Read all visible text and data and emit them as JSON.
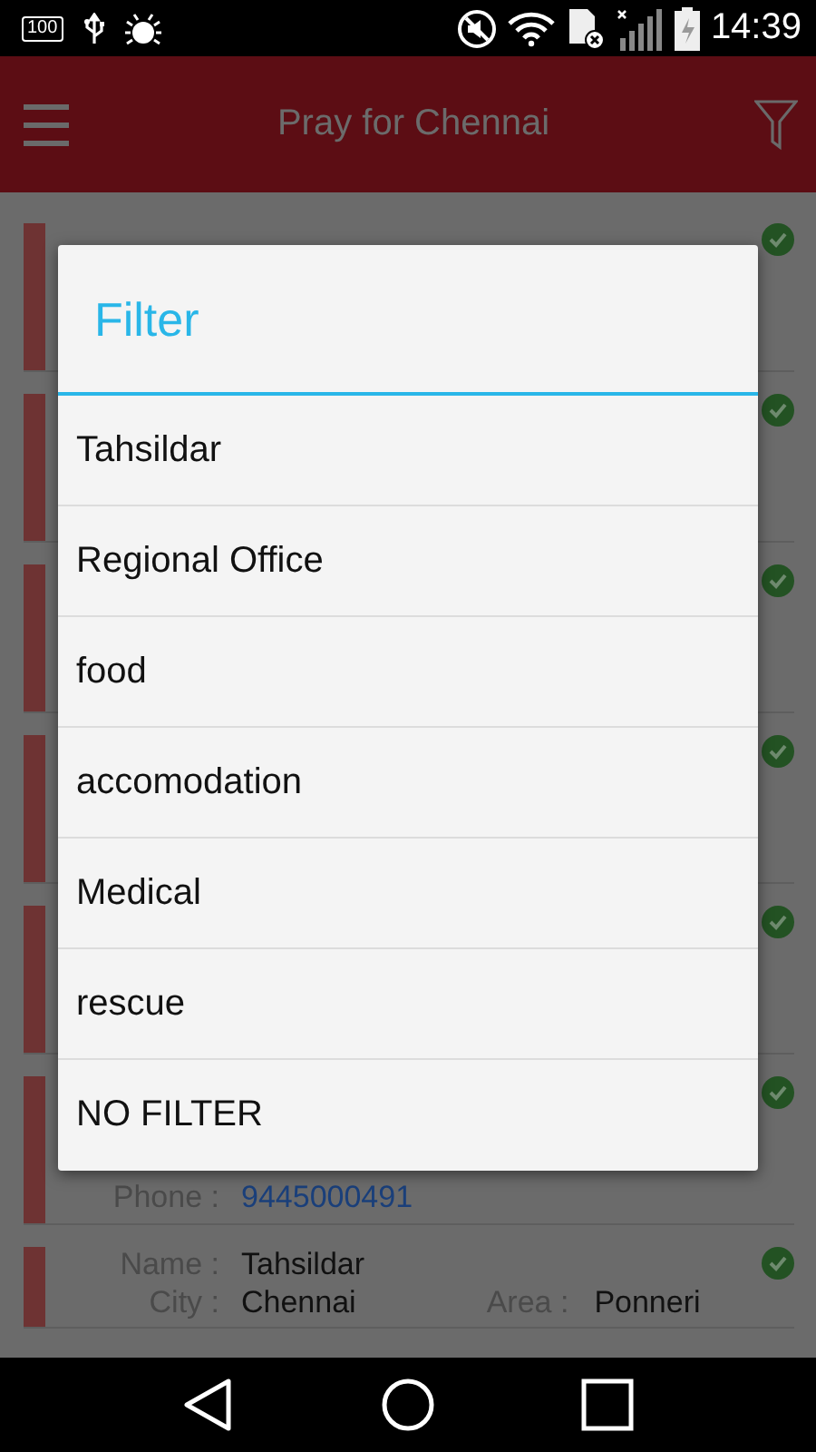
{
  "status_bar": {
    "battery_text": "100",
    "time": "14:39"
  },
  "app_bar": {
    "title": "Pray for Chennai"
  },
  "cards": [
    {
      "verified": true
    },
    {
      "verified": true
    },
    {
      "verified": true
    },
    {
      "verified": true
    },
    {
      "verified": true
    },
    {
      "verified": true,
      "rows": [
        [
          {
            "label": "Phone :",
            "value": "9445000491",
            "kind": "phone"
          }
        ]
      ]
    },
    {
      "verified": true,
      "rows": [
        [
          {
            "label": "Name :",
            "value": "Tahsildar",
            "kind": "text"
          }
        ],
        [
          {
            "label": "City :",
            "value": "Chennai",
            "kind": "text"
          },
          {
            "label": "Area :",
            "value": "Ponneri",
            "kind": "text"
          }
        ]
      ]
    }
  ],
  "dialog": {
    "title": "Filter",
    "options": [
      "Tahsildar",
      "Regional Office",
      "food",
      "accomodation",
      "Medical",
      "rescue",
      "NO FILTER"
    ]
  }
}
